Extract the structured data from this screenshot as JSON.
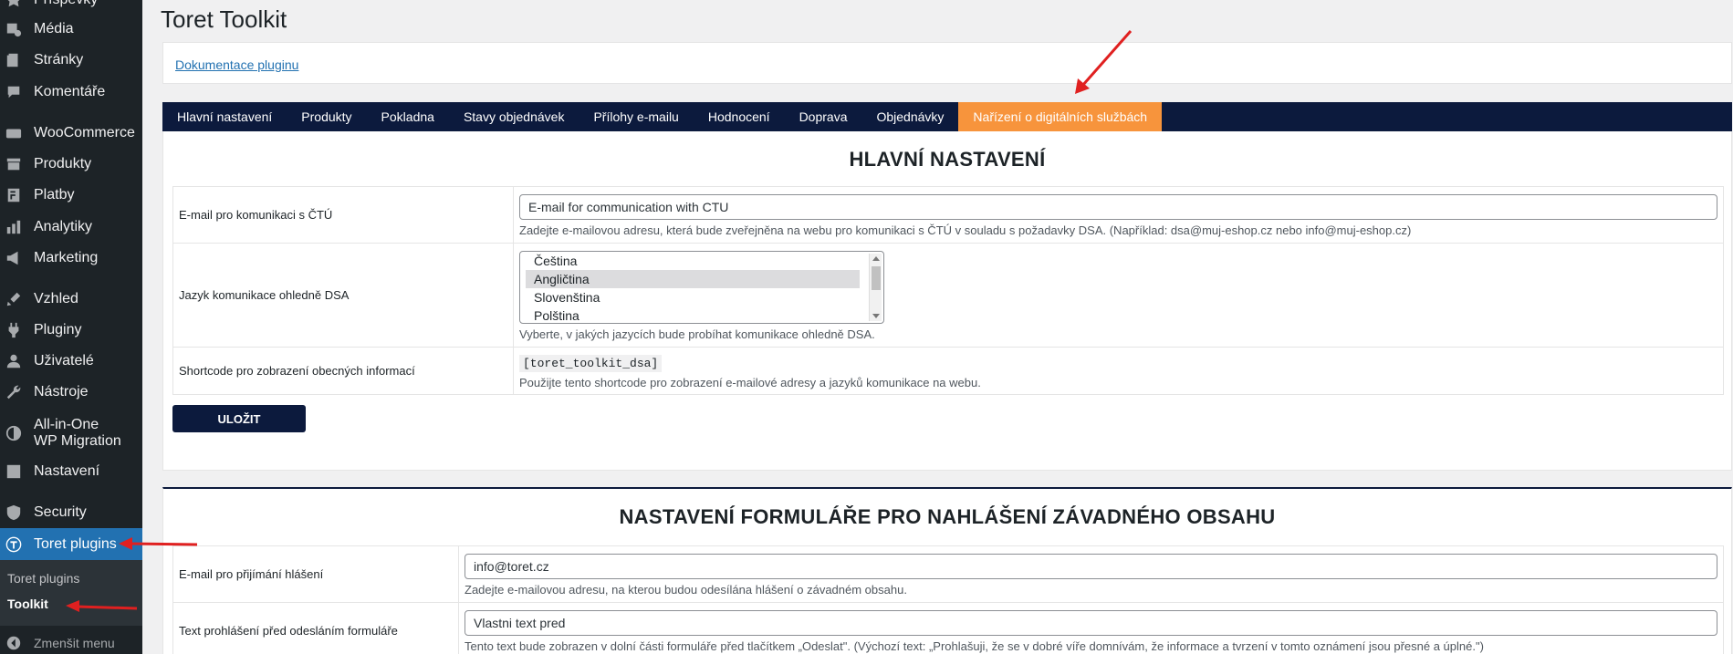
{
  "sidebar": {
    "items": [
      {
        "label": "Příspěvky",
        "icon": "pin-icon"
      },
      {
        "label": "Média",
        "icon": "media-icon"
      },
      {
        "label": "Stránky",
        "icon": "page-icon"
      },
      {
        "label": "Komentáře",
        "icon": "comment-icon"
      },
      {
        "label": "WooCommerce",
        "icon": "woo-icon"
      },
      {
        "label": "Produkty",
        "icon": "archive-icon"
      },
      {
        "label": "Platby",
        "icon": "payment-icon"
      },
      {
        "label": "Analytiky",
        "icon": "chart-icon"
      },
      {
        "label": "Marketing",
        "icon": "megaphone-icon"
      },
      {
        "label": "Vzhled",
        "icon": "brush-icon"
      },
      {
        "label": "Pluginy",
        "icon": "plugin-icon"
      },
      {
        "label": "Uživatelé",
        "icon": "user-icon"
      },
      {
        "label": "Nástroje",
        "icon": "wrench-icon"
      },
      {
        "label": "All-in-One WP Migration",
        "icon": "migration-icon"
      },
      {
        "label": "Nastavení",
        "icon": "settings-icon"
      },
      {
        "label": "Security",
        "icon": "shield-icon"
      },
      {
        "label": "Toret plugins",
        "icon": "toret-icon"
      }
    ],
    "submenu": [
      "Toret plugins",
      "Toolkit"
    ],
    "collapse_label": "Zmenšit menu"
  },
  "page": {
    "title": "Toret Toolkit",
    "doc_link": "Dokumentace pluginu"
  },
  "tabs": [
    "Hlavní nastavení",
    "Produkty",
    "Pokladna",
    "Stavy objednávek",
    "Přílohy e-mailu",
    "Hodnocení",
    "Doprava",
    "Objednávky",
    "Nařízení o digitálních službách"
  ],
  "active_tab_index": 8,
  "section1": {
    "title": "HLAVNÍ NASTAVENÍ",
    "rows": {
      "email": {
        "label": "E-mail pro komunikaci s ČTÚ",
        "value": "E-mail for communication with CTU",
        "desc": "Zadejte e-mailovou adresu, která bude zveřejněna na webu pro komunikaci s ČTÚ v souladu s požadavky DSA. (Například: dsa@muj-eshop.cz nebo info@muj-eshop.cz)"
      },
      "language": {
        "label": "Jazyk komunikace ohledně DSA",
        "options": [
          "Čeština",
          "Angličtina",
          "Slovenština",
          "Polština"
        ],
        "selected": "Angličtina",
        "desc": "Vyberte, v jakých jazycích bude probíhat komunikace ohledně DSA."
      },
      "shortcode": {
        "label": "Shortcode pro zobrazení obecných informací",
        "code": "[toret_toolkit_dsa]",
        "desc": "Použijte tento shortcode pro zobrazení e-mailové adresy a jazyků komunikace na webu."
      }
    },
    "save_label": "ULOŽIT"
  },
  "section2": {
    "title": "NASTAVENÍ FORMULÁŘE PRO NAHLÁŠENÍ ZÁVADNÉHO OBSAHU",
    "rows": {
      "report_email": {
        "label": "E-mail pro přijímání hlášení",
        "value": "info@toret.cz",
        "desc": "Zadejte e-mailovou adresu, na kterou budou odesílána hlášení o závadném obsahu."
      },
      "statement": {
        "label": "Text prohlášení před odesláním formuláře",
        "value": "Vlastni text pred",
        "desc": "Tento text bude zobrazen v dolní části formuláře před tlačítkem „Odeslat\". (Výchozí text: „Prohlašuji, že se v dobré víře domnívám, že informace a tvrzení v tomto oznámení jsou přesné a úplné.\")"
      }
    }
  },
  "colors": {
    "sidebar_bg": "#1d2327",
    "active_menu": "#2271b1",
    "tab_bar": "#0c1a3d",
    "active_tab": "#f7943c",
    "annotation_arrow": "#e02020"
  }
}
